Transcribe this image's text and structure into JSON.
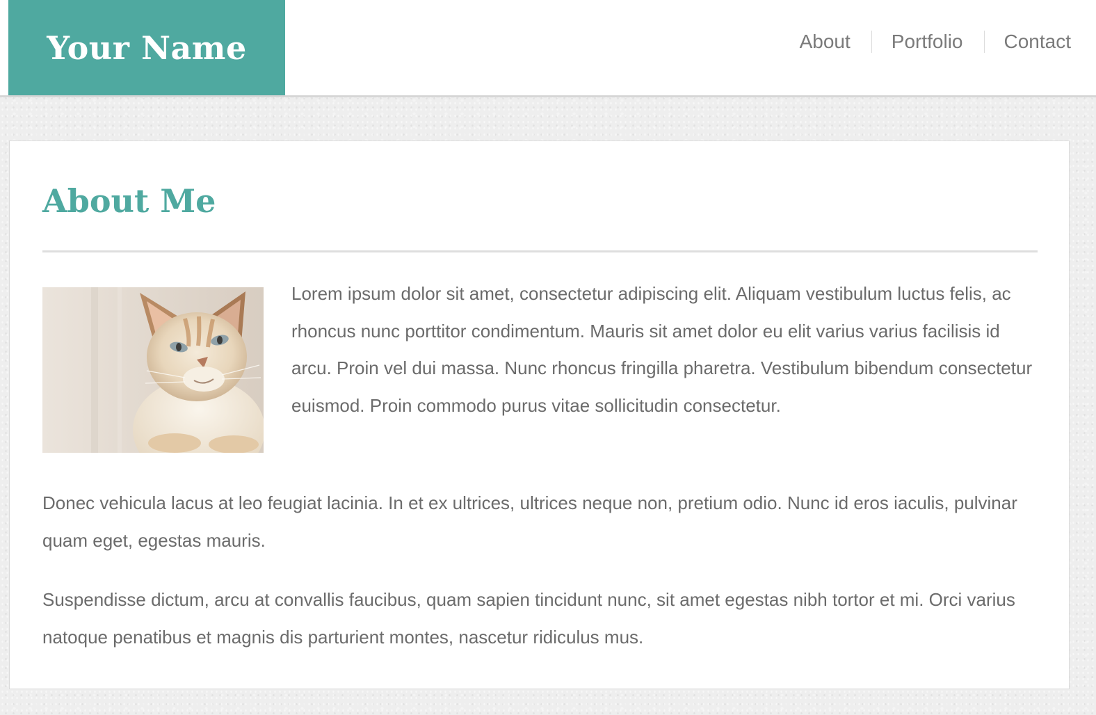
{
  "site": {
    "name": "Your Name"
  },
  "nav": {
    "items": [
      {
        "label": "About"
      },
      {
        "label": "Portfolio"
      },
      {
        "label": "Contact"
      }
    ]
  },
  "main": {
    "title": "About Me",
    "image": {
      "icon": "cat-photo"
    },
    "paragraphs": [
      "Lorem ipsum dolor sit amet, consectetur adipiscing elit. Aliquam vestibulum luctus felis, ac rhoncus nunc porttitor condimentum. Mauris sit amet dolor eu elit varius varius facilisis id arcu. Proin vel dui massa. Nunc rhoncus fringilla pharetra. Vestibulum bibendum consectetur euismod. Proin commodo purus vitae sollicitudin consectetur.",
      "Donec vehicula lacus at leo feugiat lacinia. In et ex ultrices, ultrices neque non, pretium odio. Nunc id eros iaculis, pulvinar quam eget, egestas mauris.",
      "Suspendisse dictum, arcu at convallis faucibus, quam sapien tincidunt nunc, sit amet egestas nibh tortor et mi. Orci varius natoque penatibus et magnis dis parturient montes, nascetur ridiculus mus."
    ]
  },
  "colors": {
    "accent": "#4fa9a0",
    "text": "#6b6b6b",
    "nav_text": "#7a7a7a",
    "background": "#eeeeee"
  }
}
